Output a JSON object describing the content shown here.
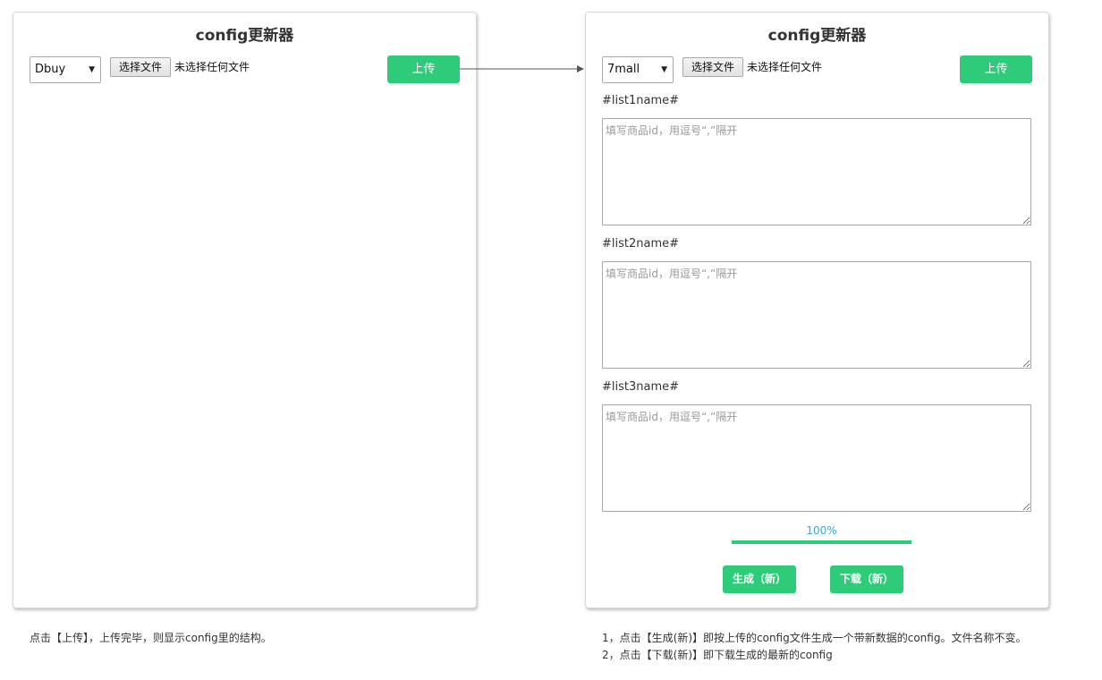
{
  "left_panel": {
    "title": "config更新器",
    "select_value": "Dbuy",
    "file_button_label": "选择文件",
    "file_status": "未选择任何文件",
    "upload_label": "上传"
  },
  "right_panel": {
    "title": "config更新器",
    "select_value": "7mall",
    "file_button_label": "选择文件",
    "file_status": "未选择任何文件",
    "upload_label": "上传",
    "lists": [
      {
        "label": "#list1name#",
        "placeholder": "填写商品id，用逗号“,”隔开"
      },
      {
        "label": "#list2name#",
        "placeholder": "填写商品id，用逗号“,”隔开"
      },
      {
        "label": "#list3name#",
        "placeholder": "填写商品id，用逗号“,”隔开"
      }
    ],
    "progress_text": "100%",
    "progress_value": 100,
    "generate_label": "生成（新）",
    "download_label": "下载（新）"
  },
  "notes": {
    "left": "点击【上传】，上传完毕，则显示config里的结构。",
    "right_line1": "1，点击【生成(新)】即按上传的config文件生成一个带新数据的config。文件名称不变。",
    "right_line2": "2，点击【下载(新)】即下载生成的最新的config"
  },
  "colors": {
    "accent_green": "#2ecc7a",
    "progress_text": "#3aa7d8"
  },
  "icons": {
    "select_caret": "▼"
  }
}
